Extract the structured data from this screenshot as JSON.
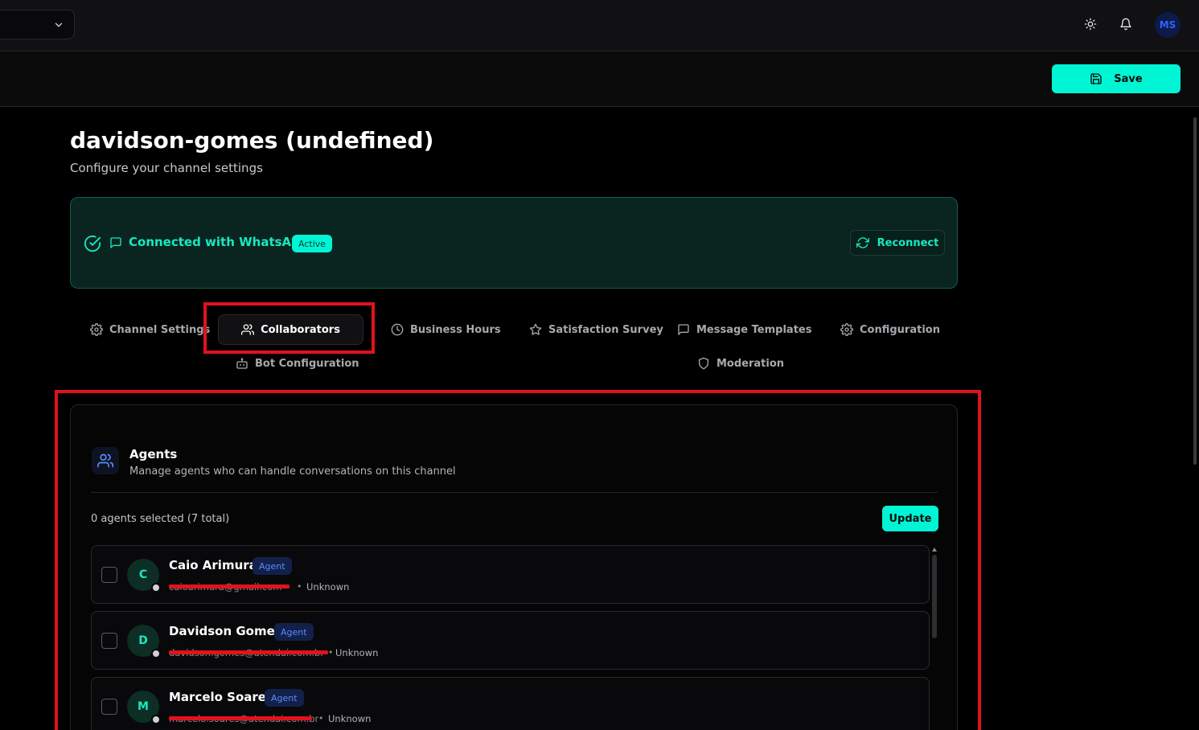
{
  "topbar": {
    "user_initials": "MS"
  },
  "actions": {
    "save_label": "Save"
  },
  "page": {
    "title": "davidson-gomes (undefined)",
    "subtitle": "Configure your channel settings"
  },
  "connection": {
    "text": "Connected with WhatsApp",
    "badge": "Active",
    "reconnect_label": "Reconnect",
    "accent_color": "#19e8c1"
  },
  "tabs": [
    {
      "label": "Channel Settings",
      "icon": "gear-icon"
    },
    {
      "label": "Collaborators",
      "icon": "users-icon",
      "active": true
    },
    {
      "label": "Business Hours",
      "icon": "clock-icon"
    },
    {
      "label": "Satisfaction Survey",
      "icon": "star-icon"
    },
    {
      "label": "Message Templates",
      "icon": "message-square-icon"
    },
    {
      "label": "Configuration",
      "icon": "gear-icon"
    },
    {
      "label": "Bot Configuration",
      "icon": "bot-icon"
    },
    {
      "label": "Moderation",
      "icon": "shield-icon"
    }
  ],
  "agents": {
    "title": "Agents",
    "description": "Manage agents who can handle conversations on this channel",
    "count_text": "0 agents selected (7 total)",
    "update_label": "Update",
    "list": [
      {
        "initial": "C",
        "name": "Caio Arimura",
        "role": "Agent",
        "email": "caioarimura@gmail.com",
        "separator": "•",
        "status": "Unknown"
      },
      {
        "initial": "D",
        "name": "Davidson Gomes",
        "role": "Agent",
        "email": "davidson.gomes@atendai.com.br",
        "separator": "•",
        "status": "Unknown"
      },
      {
        "initial": "M",
        "name": "Marcelo Soares",
        "role": "Agent",
        "email": "marcelo.soares@atendai.com.br",
        "separator": "•",
        "status": "Unknown"
      }
    ]
  }
}
